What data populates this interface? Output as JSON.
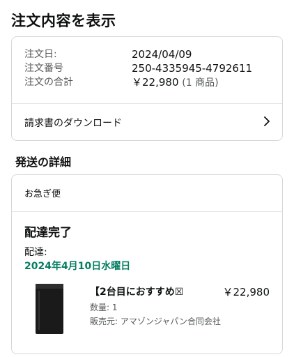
{
  "page": {
    "title": "注文内容を表示"
  },
  "order_summary": {
    "date_label": "注文日:",
    "date_value": "2024/04/09",
    "number_label": "注文番号",
    "number_value": "250-4335945-4792611",
    "total_label": "注文の合計",
    "total_value": "￥22,980",
    "total_items": "(1 商品)",
    "invoice_link": "請求書のダウンロード"
  },
  "shipping": {
    "section_title": "発送の詳細",
    "speed": "お急ぎ便",
    "status": "配達完了",
    "delivered_label": "配達:",
    "delivered_date": "2024年4月10日水曜日",
    "colors": {
      "delivered_date": "#067d62"
    },
    "item": {
      "title": "【2台目におすすめ☒",
      "price": "￥22,980",
      "quantity": "数量: 1",
      "seller": "販売元: アマゾンジャパン合同会社"
    }
  }
}
